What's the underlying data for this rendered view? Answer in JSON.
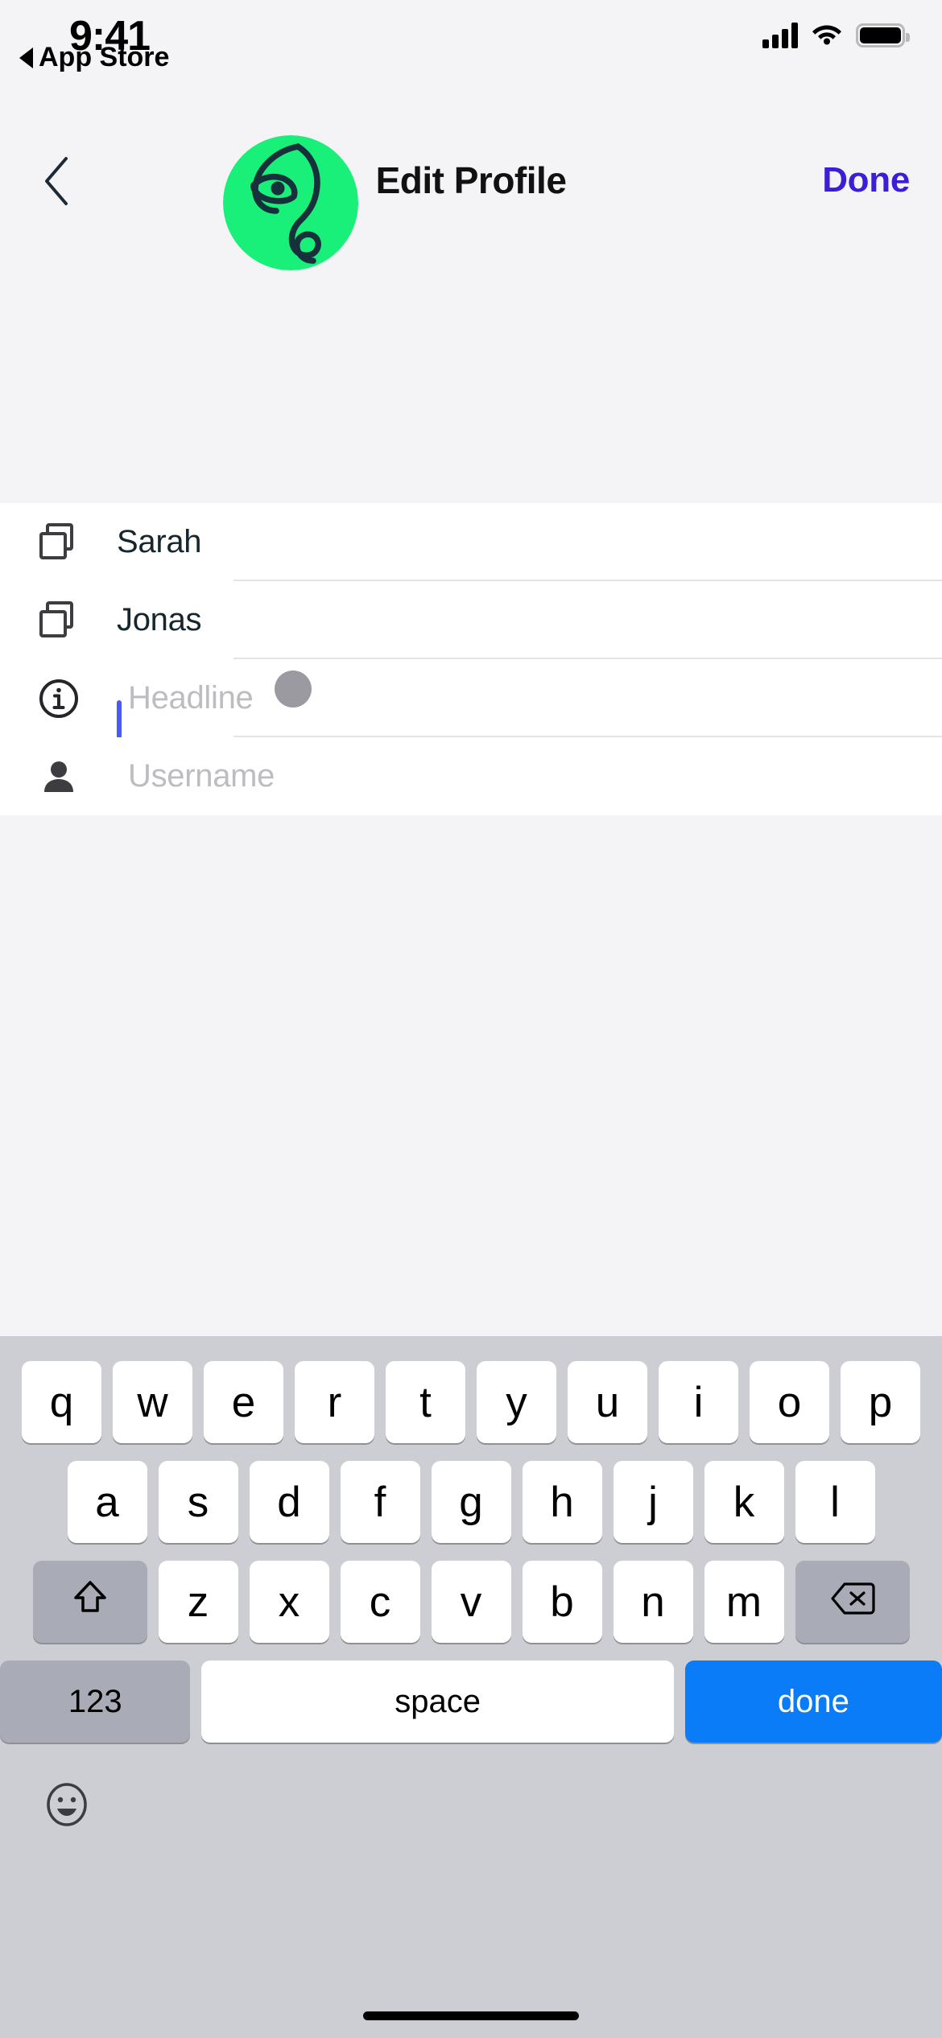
{
  "status_bar": {
    "time": "9:41",
    "back_app_label": "App Store",
    "back_triangle_icon": "triangle-left-icon",
    "cellular_icon": "cellular-signal-icon",
    "wifi_icon": "wifi-icon",
    "battery_icon": "battery-full-icon"
  },
  "nav_bar": {
    "back_icon": "chevron-left-icon",
    "title": "Edit Profile",
    "done_label": "Done",
    "done_color": "#3B1FD6"
  },
  "header": {
    "avatar_icon": "profile-avatar-line-art-face",
    "avatar_background_color": "#18F07A",
    "avatar_line_color": "#16303C"
  },
  "form": {
    "rows": [
      {
        "icon": "copy-stack-icon",
        "value": "Sarah",
        "placeholder": "",
        "focused": false
      },
      {
        "icon": "copy-stack-icon",
        "value": "Jonas",
        "placeholder": "",
        "focused": false
      },
      {
        "icon": "info-circle-icon",
        "value": "",
        "placeholder": "Headline",
        "focused": true
      },
      {
        "icon": "person-icon",
        "value": "",
        "placeholder": "Username",
        "focused": false
      }
    ],
    "caret_color": "#4A5BEF",
    "touch_indicator_color": "#9A9AA0"
  },
  "keyboard": {
    "row1": [
      "q",
      "w",
      "e",
      "r",
      "t",
      "y",
      "u",
      "i",
      "o",
      "p"
    ],
    "row2": [
      "a",
      "s",
      "d",
      "f",
      "g",
      "h",
      "j",
      "k",
      "l"
    ],
    "row3": [
      "z",
      "x",
      "c",
      "v",
      "b",
      "n",
      "m"
    ],
    "shift_icon": "shift-arrow-up-icon",
    "backspace_icon": "backspace-delete-icon",
    "numbers_label": "123",
    "space_label": "space",
    "done_label": "done",
    "done_key_color": "#0A7CF8",
    "emoji_icon": "emoji-smiley-icon",
    "home_indicator": "home-indicator-bar"
  }
}
